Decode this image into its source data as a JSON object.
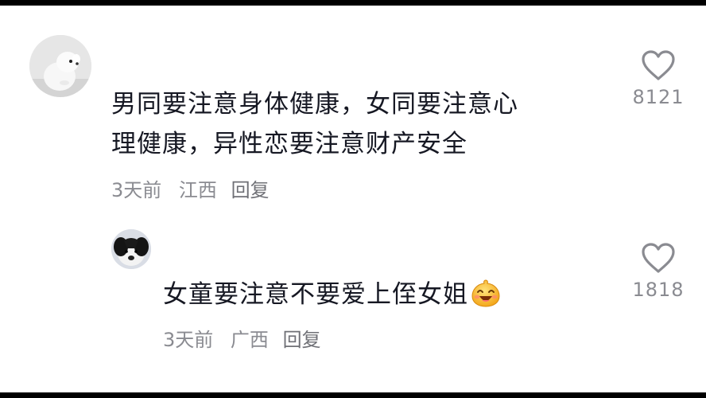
{
  "comments": [
    {
      "text_line1": "男同要注意身体健康，女同要注意心",
      "text_line2": "理健康，异性恋要注意财产安全",
      "time": "3天前",
      "location": "江西",
      "reply_label": "回复",
      "likes": "8121",
      "avatar_icon": "white-dog-avatar"
    },
    {
      "text": "女童要注意不要爱上侄女姐",
      "emoji_icon": "laughing-face-emoji",
      "time": "3天前",
      "location": "广西",
      "reply_label": "回复",
      "likes": "1818",
      "avatar_icon": "black-white-dog-avatar"
    }
  ],
  "colors": {
    "background": "#ffffff",
    "letterbox": "#000000",
    "text": "#161823",
    "meta": "#8a8b91"
  }
}
